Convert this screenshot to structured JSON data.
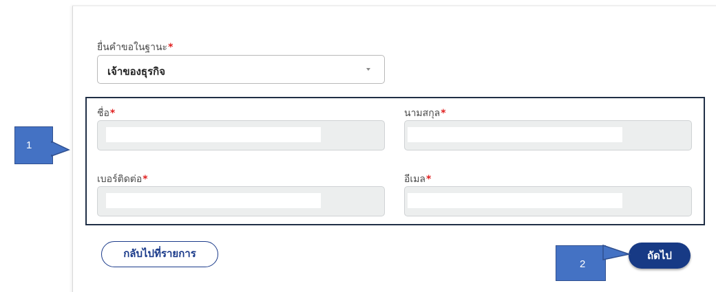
{
  "form": {
    "role_label": "ยื่นคำขอในฐานะ",
    "role_value": "เจ้าของธุรกิจ",
    "required_mark": "*",
    "fields": [
      {
        "label": "ชื่อ",
        "value": ""
      },
      {
        "label": "นามสกุล",
        "value": ""
      },
      {
        "label": "เบอร์ติดต่อ",
        "value": ""
      },
      {
        "label": "อีเมล",
        "value": ""
      }
    ]
  },
  "buttons": {
    "back_label": "กลับไปที่รายการ",
    "next_label": "ถัดไป"
  },
  "callouts": {
    "one": "1",
    "two": "2"
  },
  "colors": {
    "primary": "#173a85",
    "required": "#e02020",
    "callout_fill": "#4472c4",
    "highlight_border": "#1f2e45",
    "field_bg": "#eceeee"
  }
}
